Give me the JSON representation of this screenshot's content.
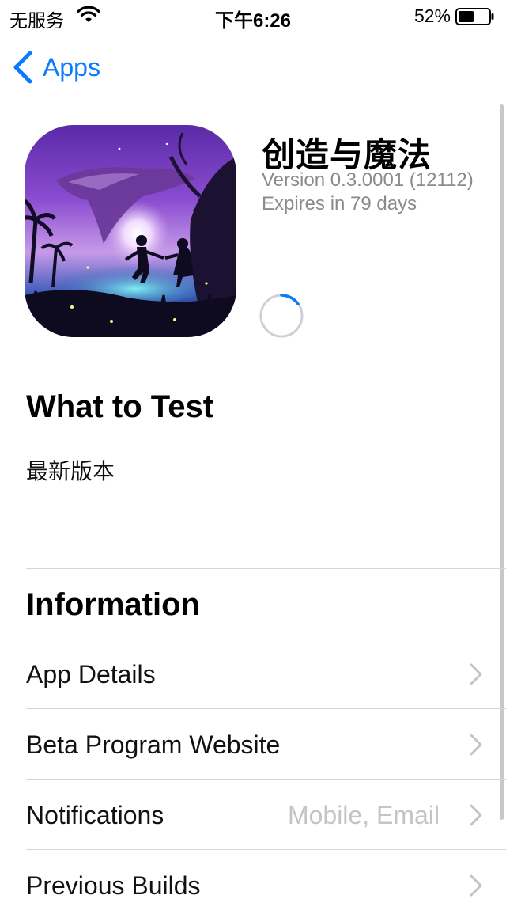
{
  "status_bar": {
    "carrier": "无服务",
    "time": "下午6:26",
    "battery_percent": "52%",
    "battery_level": 0.52
  },
  "nav": {
    "back_label": "Apps"
  },
  "app": {
    "name": "创造与魔法",
    "version": "Version 0.3.0001 (12112)",
    "expires": "Expires in 79 days"
  },
  "what_to_test": {
    "heading": "What to Test",
    "body": "最新版本"
  },
  "information": {
    "heading": "Information",
    "rows": [
      {
        "label": "App Details",
        "value": ""
      },
      {
        "label": "Beta Program Website",
        "value": ""
      },
      {
        "label": "Notifications",
        "value": "Mobile, Email"
      },
      {
        "label": "Previous Builds",
        "value": ""
      }
    ]
  },
  "colors": {
    "accent": "#0a7aff",
    "secondary_text": "#8a8a8f",
    "separator": "#d6d6da"
  }
}
